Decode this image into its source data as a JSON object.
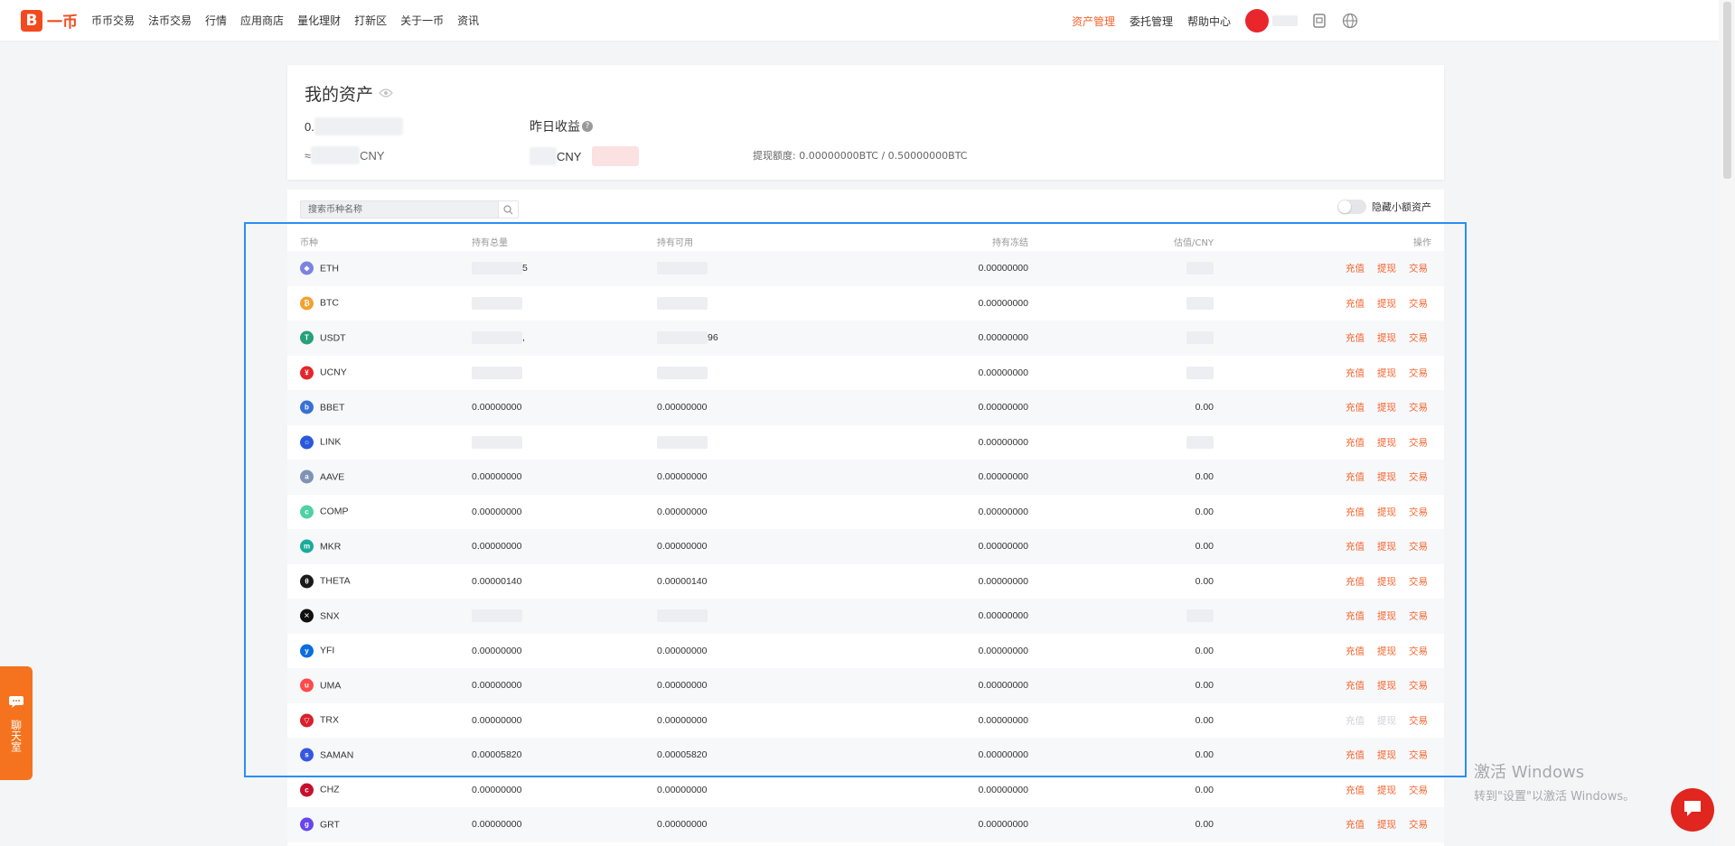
{
  "header": {
    "logo_mark": "B",
    "logo_text": "一币",
    "nav": [
      "币币交易",
      "法币交易",
      "行情",
      "应用商店",
      "量化理财",
      "打新区",
      "关于一币",
      "资讯"
    ],
    "right_nav": [
      "资产管理",
      "委托管理",
      "帮助中心"
    ]
  },
  "summary": {
    "title": "我的资产",
    "btc_prefix": "0.",
    "cny_prefix": "≈ ",
    "cny_unit": "CNY",
    "yesterday_label": "昨日收益",
    "yesterday_unit": "CNY",
    "withdraw_quota": "提现额度: 0.00000000BTC / 0.50000000BTC"
  },
  "toolbar": {
    "search_placeholder": "搜索币种名称",
    "hide_small_label": "隐藏小额资产"
  },
  "table": {
    "headers": [
      "币种",
      "持有总量",
      "持有可用",
      "持有冻结",
      "估值/CNY",
      "操作"
    ],
    "action_labels": [
      "充值",
      "提现",
      "交易"
    ],
    "rows": [
      {
        "coin": "ETH",
        "color": "#7b83e3",
        "glyph": "◆",
        "total": "",
        "total_suffix": "5",
        "available": "",
        "frozen": "0.00000000",
        "value": "",
        "withdraw_enabled": true
      },
      {
        "coin": "BTC",
        "color": "#f2a12e",
        "glyph": "₿",
        "total": "",
        "total_suffix": "",
        "available": "",
        "frozen": "0.00000000",
        "value": "",
        "withdraw_enabled": true
      },
      {
        "coin": "USDT",
        "color": "#26a17b",
        "glyph": "T",
        "total": "",
        "total_suffix": ",",
        "available": "",
        "available_suffix": "96",
        "frozen": "0.00000000",
        "value": "",
        "withdraw_enabled": true
      },
      {
        "coin": "UCNY",
        "color": "#e3262c",
        "glyph": "¥",
        "total": "",
        "total_suffix": "",
        "available": "",
        "frozen": "0.00000000",
        "value": "",
        "withdraw_enabled": true
      },
      {
        "coin": "BBET",
        "color": "#3a6fd6",
        "glyph": "b",
        "total": "0.00000000",
        "available": "0.00000000",
        "frozen": "0.00000000",
        "value": "0.00",
        "withdraw_enabled": true
      },
      {
        "coin": "LINK",
        "color": "#2a5ada",
        "glyph": "○",
        "total": "",
        "total_suffix": "",
        "available": "",
        "frozen": "0.00000000",
        "value": "",
        "withdraw_enabled": true
      },
      {
        "coin": "AAVE",
        "color": "#7f93b4",
        "glyph": "a",
        "total": "0.00000000",
        "available": "0.00000000",
        "frozen": "0.00000000",
        "value": "0.00",
        "withdraw_enabled": true
      },
      {
        "coin": "COMP",
        "color": "#4fd1a5",
        "glyph": "c",
        "total": "0.00000000",
        "available": "0.00000000",
        "frozen": "0.00000000",
        "value": "0.00",
        "withdraw_enabled": true
      },
      {
        "coin": "MKR",
        "color": "#1aab9b",
        "glyph": "m",
        "total": "0.00000000",
        "available": "0.00000000",
        "frozen": "0.00000000",
        "value": "0.00",
        "withdraw_enabled": true
      },
      {
        "coin": "THETA",
        "color": "#1a1a1a",
        "glyph": "θ",
        "total": "0.00000140",
        "available": "0.00000140",
        "frozen": "0.00000000",
        "value": "0.00",
        "withdraw_enabled": true
      },
      {
        "coin": "SNX",
        "color": "#111111",
        "glyph": "✕",
        "total": "",
        "total_suffix": "",
        "available": "",
        "frozen": "0.00000000",
        "value": "",
        "withdraw_enabled": true
      },
      {
        "coin": "YFI",
        "color": "#0b6ede",
        "glyph": "y",
        "total": "0.00000000",
        "available": "0.00000000",
        "frozen": "0.00000000",
        "value": "0.00",
        "withdraw_enabled": true
      },
      {
        "coin": "UMA",
        "color": "#ff4a4a",
        "glyph": "u",
        "total": "0.00000000",
        "available": "0.00000000",
        "frozen": "0.00000000",
        "value": "0.00",
        "withdraw_enabled": true
      },
      {
        "coin": "TRX",
        "color": "#d9202c",
        "glyph": "▽",
        "total": "0.00000000",
        "available": "0.00000000",
        "frozen": "0.00000000",
        "value": "0.00",
        "withdraw_enabled": false
      },
      {
        "coin": "SAMAN",
        "color": "#3658e0",
        "glyph": "s",
        "total": "0.00005820",
        "available": "0.00005820",
        "frozen": "0.00000000",
        "value": "0.00",
        "withdraw_enabled": true
      },
      {
        "coin": "CHZ",
        "color": "#c8102e",
        "glyph": "c",
        "total": "0.00000000",
        "available": "0.00000000",
        "frozen": "0.00000000",
        "value": "0.00",
        "withdraw_enabled": true
      },
      {
        "coin": "GRT",
        "color": "#6747ed",
        "glyph": "g",
        "total": "0.00000000",
        "available": "0.00000000",
        "frozen": "0.00000000",
        "value": "0.00",
        "withdraw_enabled": true
      }
    ]
  },
  "side_chat": {
    "label": "聊天室"
  },
  "watermark": {
    "line1": "激活 Windows",
    "line2": "转到\"设置\"以激活 Windows。"
  },
  "colors": {
    "brand": "#f24a1e",
    "accent": "#f5622b",
    "highlight": "#2a8ef5"
  }
}
